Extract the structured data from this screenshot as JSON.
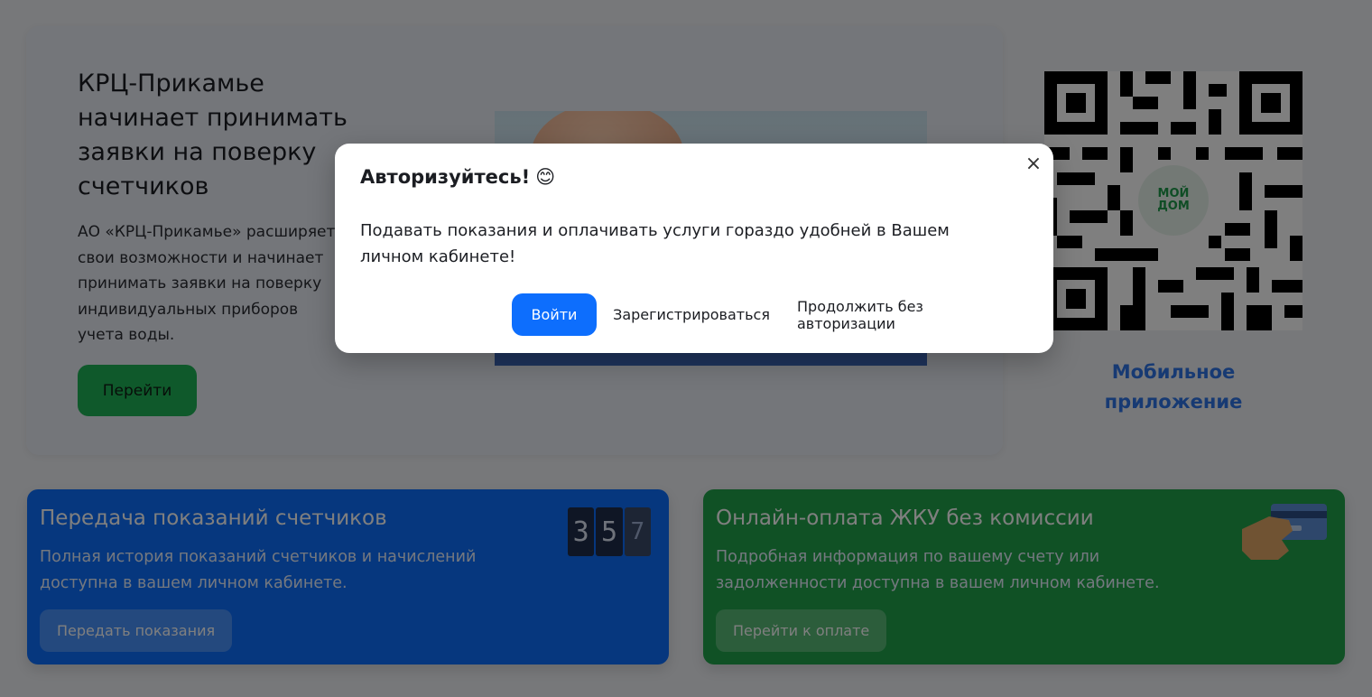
{
  "hero": {
    "title": "КРЦ-Прикамье начинает принимать заявки на поверку счетчиков",
    "text": "АО «КРЦ-Прикамье» расширяет свои возможности и начинает принимать заявки на поверку индивидуальных приборов учета воды.",
    "button_label": "Перейти",
    "accent": "#1fb356"
  },
  "mobile_app": {
    "qr_icon": "qr-code-icon",
    "badge_lines": [
      "МОЙ",
      "ДОМ"
    ],
    "caption": "Мобильное приложение",
    "caption_color": "#2f74e6"
  },
  "cards": {
    "meters": {
      "title": "Передача показаний счетчиков",
      "text": "Полная история показаний счетчиков и начислений доступна в вашем личном кабинете.",
      "button_label": "Передать показания",
      "counter_digits": [
        "3",
        "5",
        "7"
      ],
      "color": "#0d6efd"
    },
    "payment": {
      "title": "Онлайн-оплата ЖКУ без комиссии",
      "text": "Подробная информация по вашему счету или задолженности доступна в вашем личном кабинете.",
      "button_label": "Перейти к оплате",
      "icon": "credit-card-icon",
      "color": "#20a34a"
    }
  },
  "modal": {
    "title": "Авторизуйтесь!",
    "emoji": "😊",
    "close_symbol": "×",
    "text": "Подавать показания и оплачивать услуги гораздо удобней в Вашем личном кабинете!",
    "login_label": "Войти",
    "register_label": "Зарегистрироваться",
    "continue_label": "Продолжить без авторизации",
    "primary_color": "#0d6efd"
  }
}
